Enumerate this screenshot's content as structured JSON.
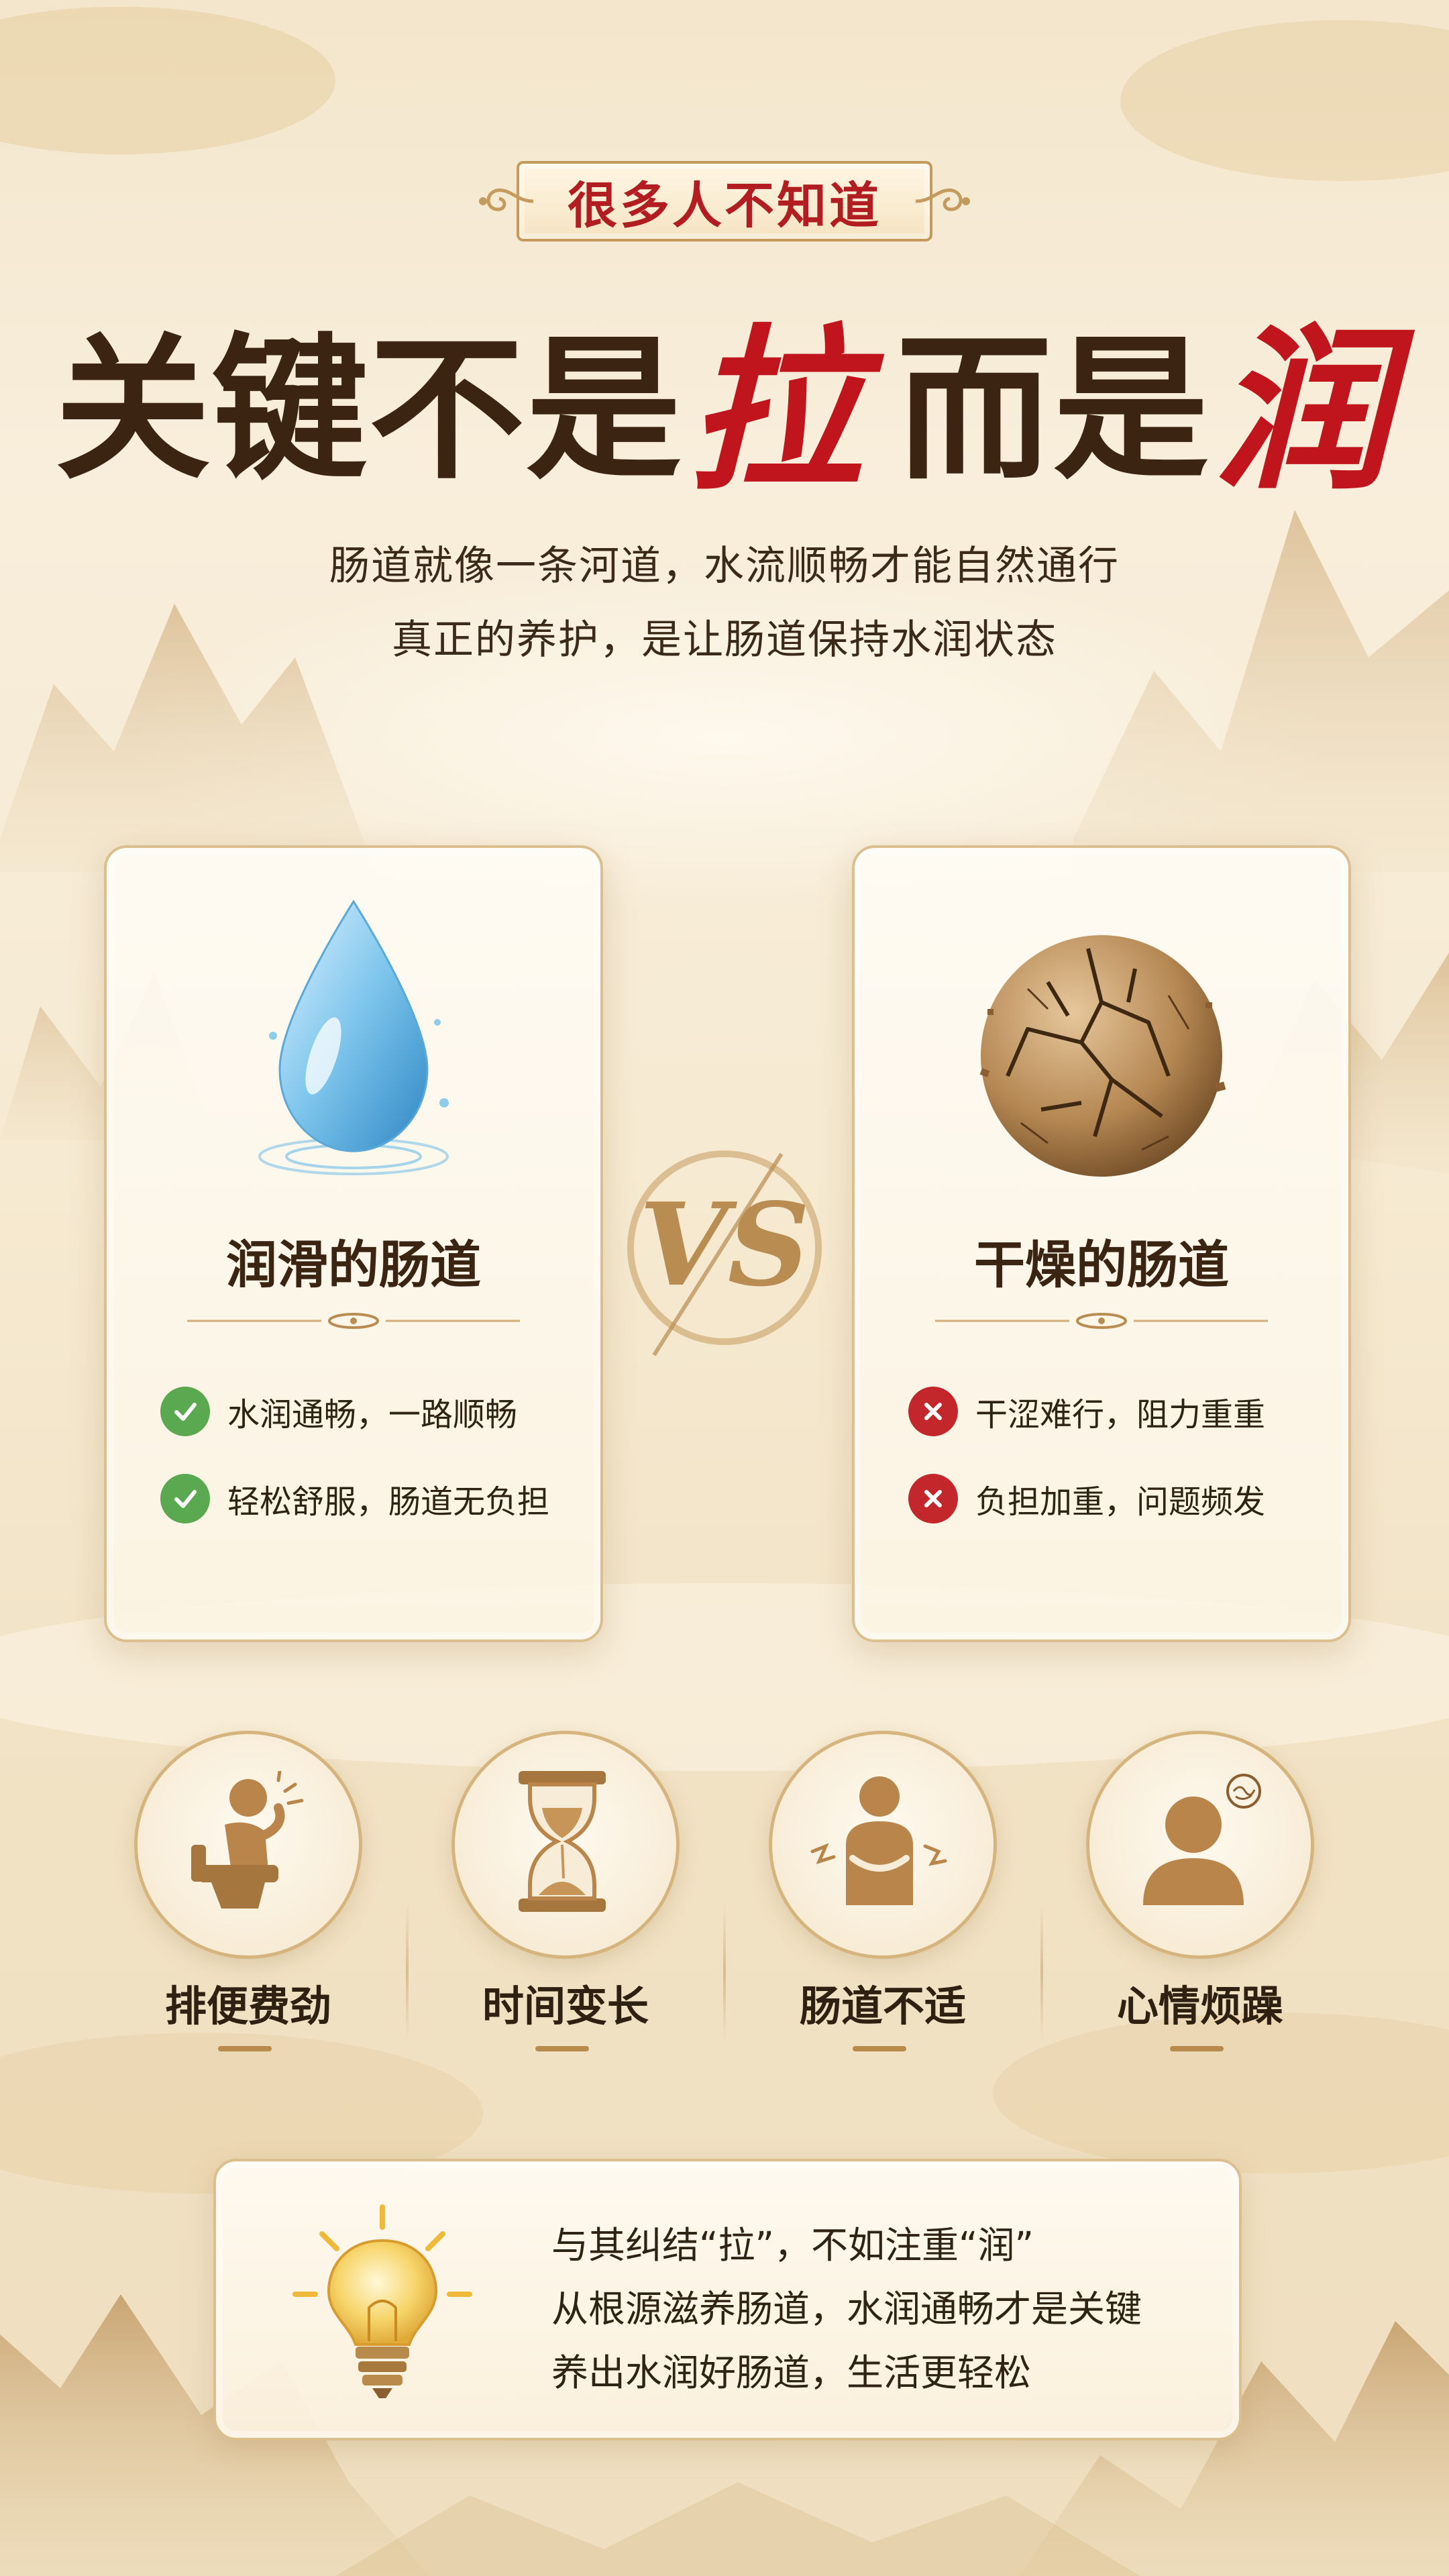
{
  "badge": {
    "text": "很多人不知道"
  },
  "headline": {
    "part1": "关键不是",
    "highlight1": "拉",
    "part2": "而是",
    "highlight2": "润"
  },
  "subtitle": {
    "line1": "肠道就像一条河道，水流顺畅才能自然通行",
    "line2": "真正的养护，是让肠道保持水润状态"
  },
  "left_card": {
    "icon": "water-drop-icon",
    "title": "润滑的肠道",
    "points": [
      "水润通畅，一路顺畅",
      "轻松舒服，肠道无负担"
    ]
  },
  "vs_label": "VS",
  "right_card": {
    "icon": "cracked-ball-icon",
    "title": "干燥的肠道",
    "points": [
      "干涩难行，阻力重重",
      "负担加重，问题频发"
    ]
  },
  "symptoms": [
    {
      "icon": "toilet-person-icon",
      "label": "排便费劲"
    },
    {
      "icon": "hourglass-icon",
      "label": "时间变长"
    },
    {
      "icon": "stomach-discomfort-icon",
      "label": "肠道不适"
    },
    {
      "icon": "irritated-person-icon",
      "label": "心情烦躁"
    }
  ],
  "tip": {
    "icon": "light-bulb-icon",
    "lines": [
      "与其纠结“拉”，不如注重“润”",
      "从根源滋养肠道，水润通畅才是关键",
      "养出水润好肠道，生活更轻松"
    ]
  },
  "colors": {
    "accent_red": "#c0151d",
    "gold": "#c59a5d",
    "dark_text": "#3b2512",
    "check_green": "#5aa84f",
    "cross_red": "#c3272b"
  }
}
